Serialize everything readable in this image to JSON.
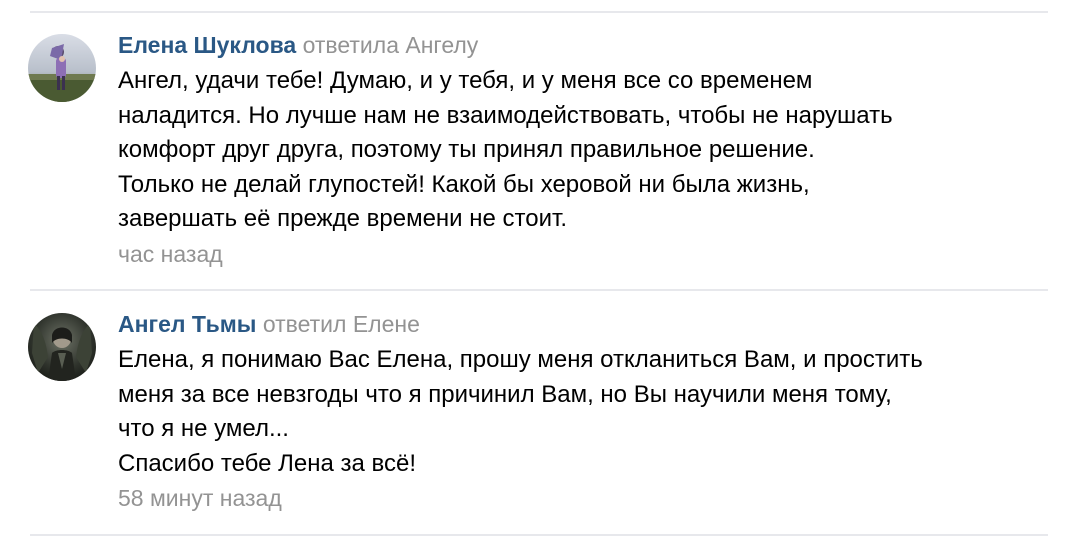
{
  "comments": [
    {
      "author": "Елена Шуклова",
      "reply_to": "ответила Ангелу",
      "text_lines": [
        "Ангел, удачи тебе! Думаю, и у тебя, и у меня все со временем",
        "наладится. Но лучше нам не взаимодействовать, чтобы не нарушать",
        "комфорт друг друга, поэтому ты принял правильное решение.",
        "Только не делай глупостей! Какой бы херовой ни была жизнь,",
        "завершать её прежде времени не стоит."
      ],
      "date": "час назад"
    },
    {
      "author": "Ангел Тьмы",
      "reply_to": "ответил Елене",
      "text_lines": [
        "Елена, я понимаю Вас Елена, прошу меня откланиться Вам, и простить",
        "меня за все невзгоды что я причинил Вам, но Вы научили меня тому,",
        "что я не умел...",
        "Спасибо тебе Лена за всё!"
      ],
      "date": "58 минут назад"
    }
  ],
  "colors": {
    "author_link": "#2a5885",
    "muted_text": "#939393",
    "divider": "#e7e8ec"
  }
}
